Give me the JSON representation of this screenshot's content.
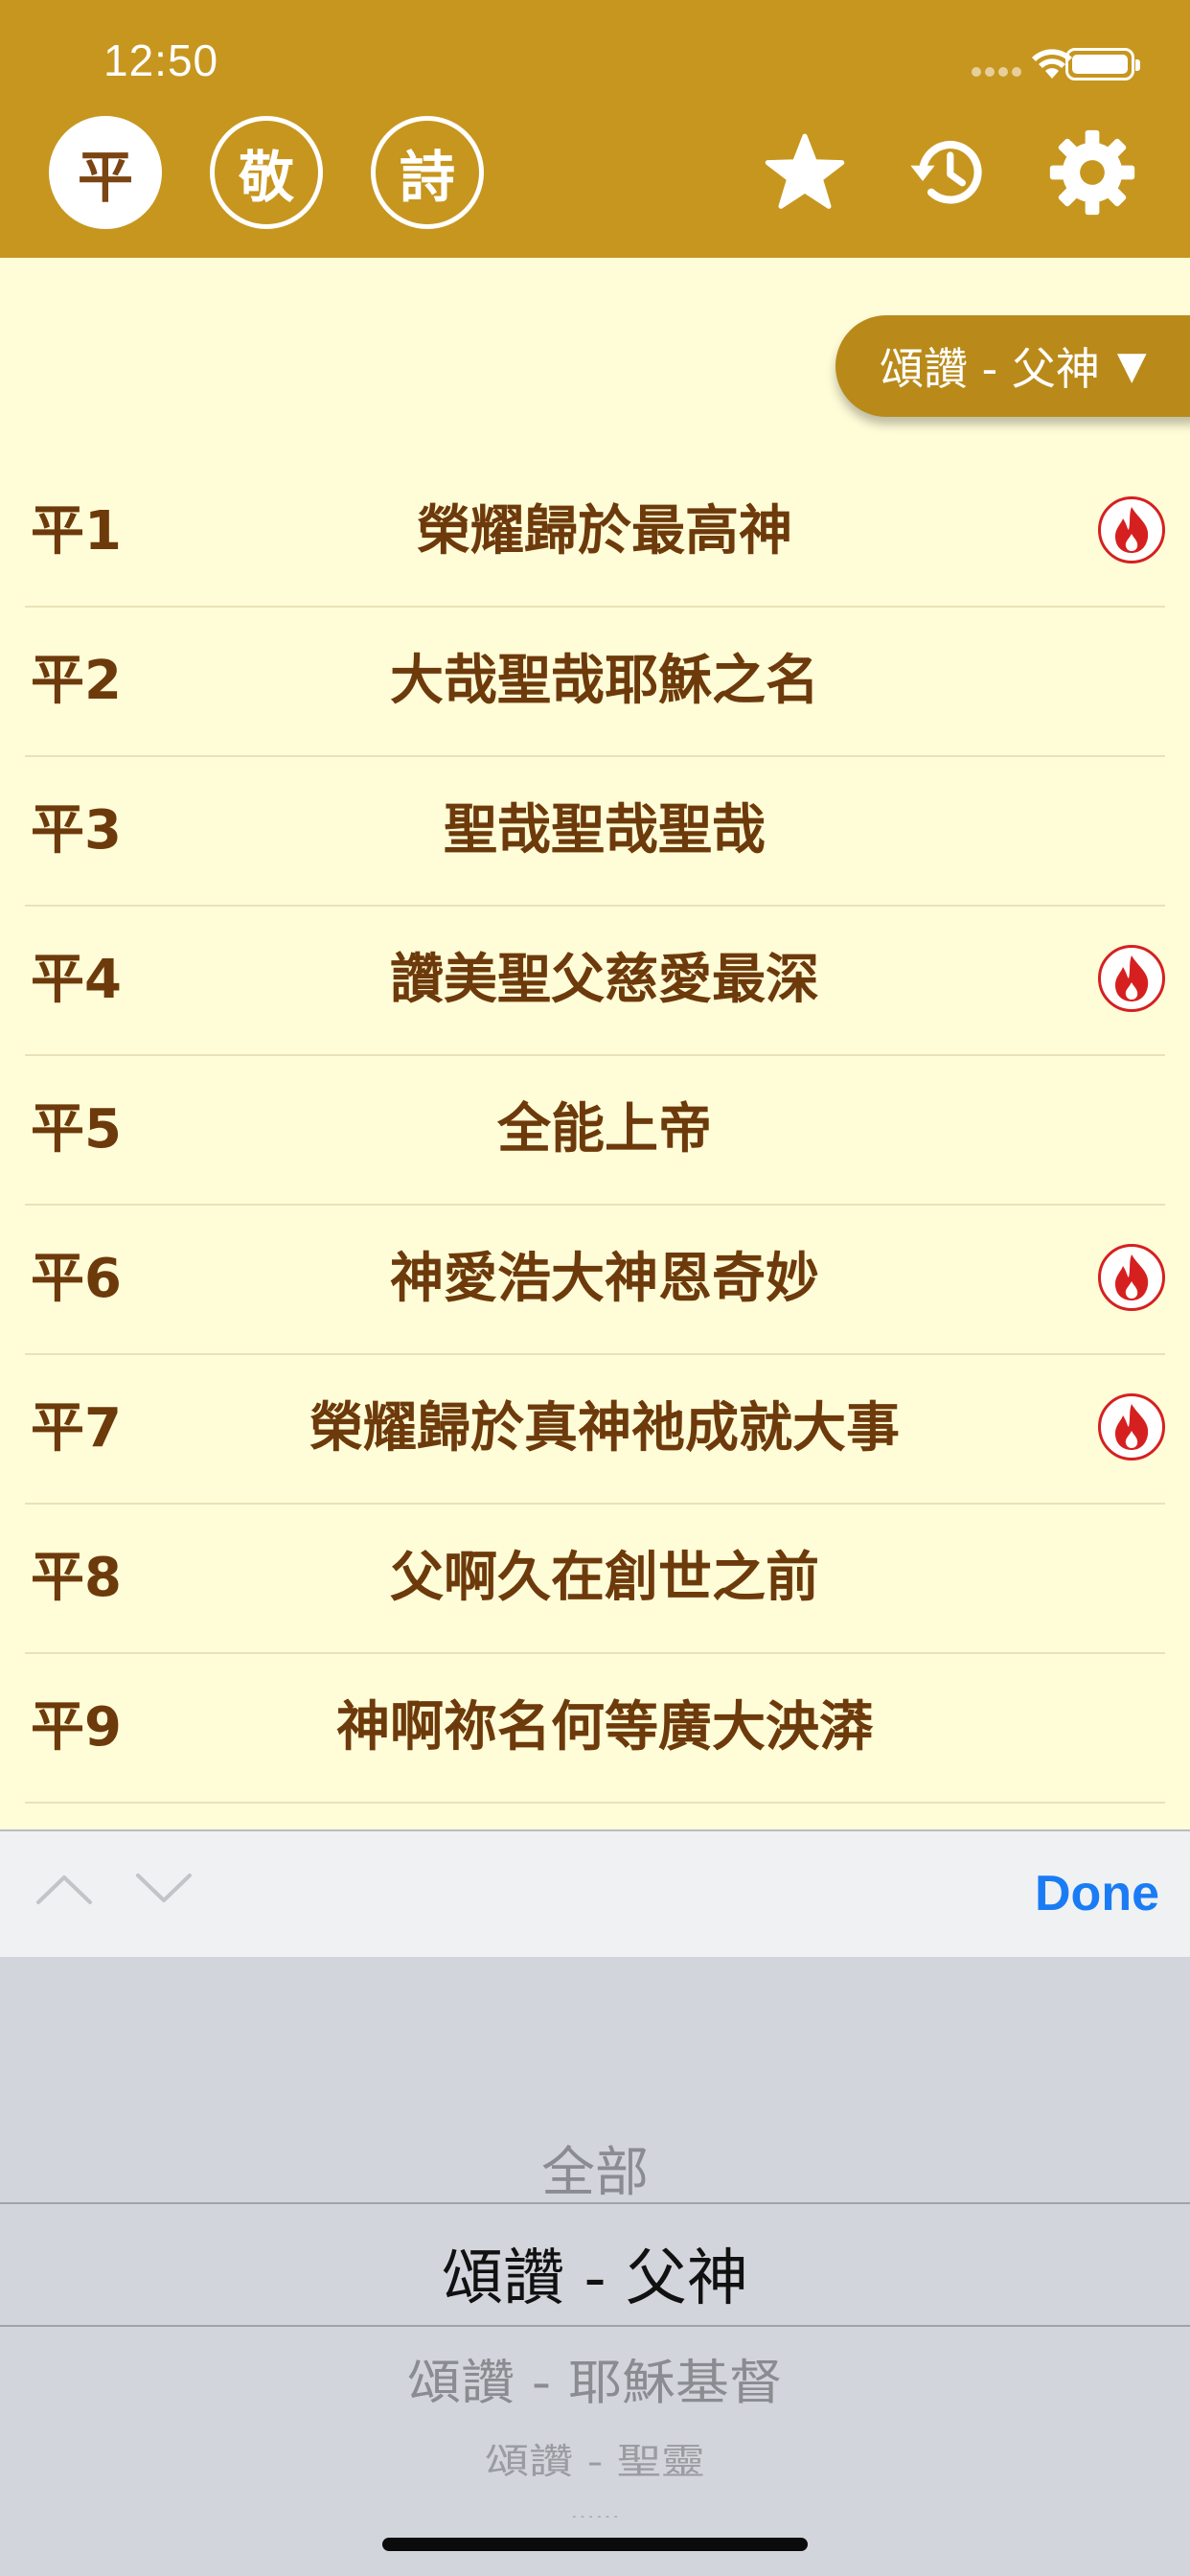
{
  "status_bar": {
    "time": "12:50"
  },
  "header": {
    "modes": [
      {
        "label": "平",
        "active": true
      },
      {
        "label": "敬",
        "active": false
      },
      {
        "label": "詩",
        "active": false
      }
    ],
    "icons": [
      "star-icon",
      "history-icon",
      "gear-icon"
    ],
    "background_color": "#c7961f"
  },
  "filter": {
    "label": "頌讚 - 父神",
    "arrow": "▼"
  },
  "hymns": [
    {
      "num": "平1",
      "title": "榮耀歸於最高神",
      "popular": true
    },
    {
      "num": "平2",
      "title": "大哉聖哉耶穌之名",
      "popular": false
    },
    {
      "num": "平3",
      "title": "聖哉聖哉聖哉",
      "popular": false
    },
    {
      "num": "平4",
      "title": "讚美聖父慈愛最深",
      "popular": true
    },
    {
      "num": "平5",
      "title": "全能上帝",
      "popular": false
    },
    {
      "num": "平6",
      "title": "神愛浩大神恩奇妙",
      "popular": true
    },
    {
      "num": "平7",
      "title": "榮耀歸於真神祂成就大事",
      "popular": true
    },
    {
      "num": "平8",
      "title": "父啊久在創世之前",
      "popular": false
    },
    {
      "num": "平9",
      "title": "神啊祢名何等廣大泱漭",
      "popular": false
    }
  ],
  "toolbar": {
    "done_label": "Done"
  },
  "picker": {
    "options": [
      "全部",
      "頌讚 - 父神",
      "頌讚 - 耶穌基督",
      "頌讚 - 聖靈",
      "……"
    ],
    "selected": "頌讚 - 父神"
  },
  "colors": {
    "text_brown": "#6d3a0c",
    "list_bg": "#fffdd8",
    "fire_red": "#d62020",
    "done_blue": "#1a7cf5"
  }
}
